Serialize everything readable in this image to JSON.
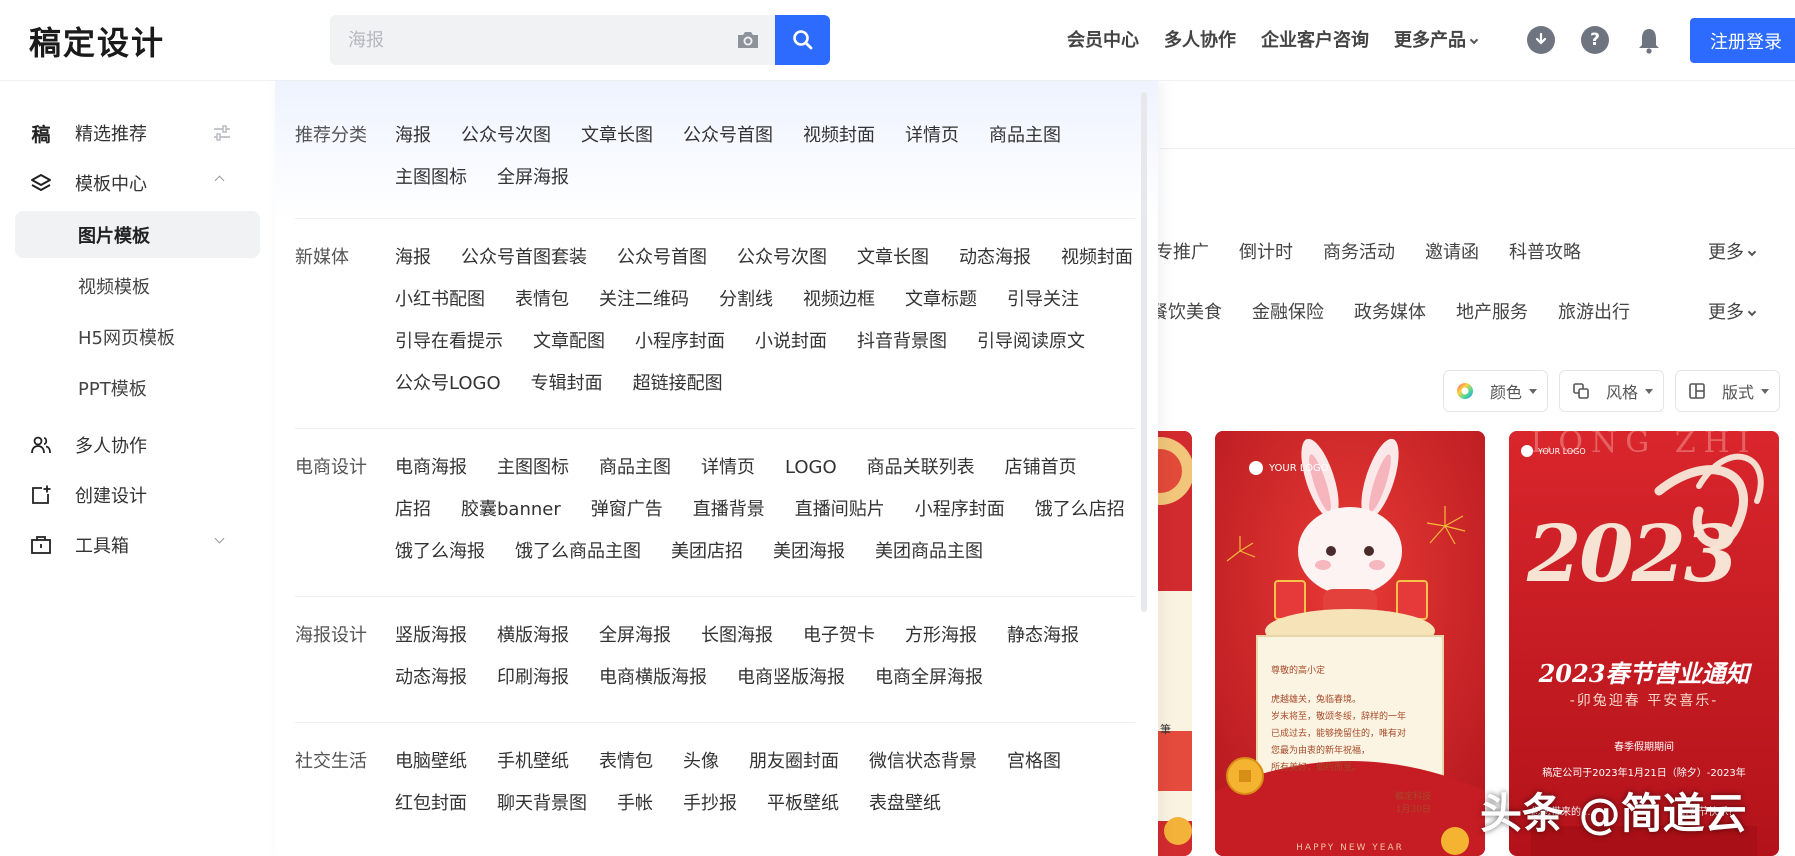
{
  "header": {
    "logo": "稿定设计",
    "search_placeholder": "海报",
    "nav": [
      "会员中心",
      "多人协作",
      "企业客户咨询",
      "更多产品"
    ],
    "register_label": "注册登录"
  },
  "sidebar": {
    "items": [
      {
        "label": "精选推荐",
        "icon": "logo-mark-icon"
      },
      {
        "label": "模板中心",
        "icon": "layers-icon"
      },
      {
        "label": "多人协作",
        "icon": "users-icon"
      },
      {
        "label": "创建设计",
        "icon": "create-icon"
      },
      {
        "label": "工具箱",
        "icon": "toolbox-icon"
      }
    ],
    "logo_mark": "稿",
    "sub_items": [
      "图片模板",
      "视频模板",
      "H5网页模板",
      "PPT模板"
    ],
    "active_sub": "图片模板"
  },
  "dropdown": {
    "categories": [
      {
        "title": "推荐分类",
        "items": [
          "海报",
          "公众号次图",
          "文章长图",
          "公众号首图",
          "视频封面",
          "详情页",
          "商品主图",
          "主图图标",
          "全屏海报"
        ]
      },
      {
        "title": "新媒体",
        "items": [
          "海报",
          "公众号首图套装",
          "公众号首图",
          "公众号次图",
          "文章长图",
          "动态海报",
          "视频封面",
          "小红书配图",
          "表情包",
          "关注二维码",
          "分割线",
          "视频边框",
          "文章标题",
          "引导关注",
          "引导在看提示",
          "文章配图",
          "小程序封面",
          "小说封面",
          "抖音背景图",
          "引导阅读原文",
          "公众号LOGO",
          "专辑封面",
          "超链接配图"
        ]
      },
      {
        "title": "电商设计",
        "items": [
          "电商海报",
          "主图图标",
          "商品主图",
          "详情页",
          "LOGO",
          "商品关联列表",
          "店铺首页",
          "店招",
          "胶囊banner",
          "弹窗广告",
          "直播背景",
          "直播间贴片",
          "小程序封面",
          "饿了么店招",
          "饿了么海报",
          "饿了么商品主图",
          "美团店招",
          "美团海报",
          "美团商品主图"
        ]
      },
      {
        "title": "海报设计",
        "items": [
          "竖版海报",
          "横版海报",
          "全屏海报",
          "长图海报",
          "电子贺卡",
          "方形海报",
          "静态海报",
          "动态海报",
          "印刷海报",
          "电商横版海报",
          "电商竖版海报",
          "电商全屏海报"
        ]
      },
      {
        "title": "社交生活",
        "items": [
          "电脑壁纸",
          "手机壁纸",
          "表情包",
          "头像",
          "朋友圈封面",
          "微信状态背景",
          "宫格图",
          "红包封面",
          "聊天背景图",
          "手帐",
          "手抄报",
          "平板壁纸",
          "表盘壁纸"
        ]
      }
    ]
  },
  "background": {
    "tag_row1": [
      "专推广",
      "倒计时",
      "商务活动",
      "邀请函",
      "科普攻略"
    ],
    "tag_row2": [
      "餐饮美食",
      "金融保险",
      "政务媒体",
      "地产服务",
      "旅游出行"
    ],
    "more_label": "更多",
    "filters": [
      "颜色",
      "风格",
      "版式"
    ],
    "card2": {
      "logo": "YOUR LOGO",
      "greeting": "尊敬的高小定",
      "lines": [
        "虎越雄关，兔临春境。",
        "岁末将至，敬颂冬绥，辞样的一年",
        "已成过去，能够挽留住的，唯有对",
        "您最为由衷的新年祝福，",
        "所有美好，如约而至。"
      ],
      "sign": "稿定科技",
      "date": "1月30日",
      "footer": "HAPPY NEW YEAR"
    },
    "card3": {
      "logo": "YOUR LOGO",
      "top_letters": "LONG ZHI",
      "year": "2023",
      "title": "2023春节营业通知",
      "subtitle": "-卯兔迎春  平安喜乐-",
      "period": "春季假期期间",
      "notice": "稿定公司于2023年1月21日（除夕）-2023年",
      "notice2": "您您带来的...",
      "wish": "...春节快乐!"
    },
    "card1_partial": "筆"
  },
  "watermark": "头条 @简道云",
  "colors": {
    "accent": "#2d6bff",
    "poster_red": "#d8262b"
  }
}
